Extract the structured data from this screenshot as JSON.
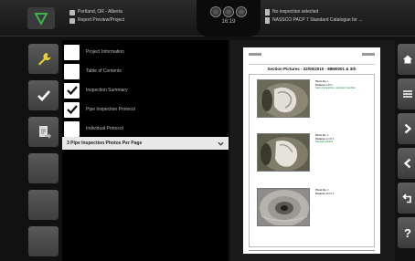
{
  "topbar": {
    "project_line1": "Portland, OR - Alberta",
    "project_line2": "Report Preview/Project",
    "clock": "16:19",
    "inspection_line1": "No inspection selected",
    "inspection_line2": "NASSCO PACP 7 Standard Catalogue for ..."
  },
  "sidebar": {
    "items": [
      {
        "icon": "wrench-icon",
        "active": true
      },
      {
        "icon": "checkmark-icon",
        "active": true
      },
      {
        "icon": "report-export-icon",
        "active": true
      },
      {
        "icon": "",
        "active": false
      },
      {
        "icon": "",
        "active": false
      },
      {
        "icon": "",
        "active": false
      }
    ]
  },
  "options": [
    {
      "label": "Project Information",
      "checked": false
    },
    {
      "label": "Table of Contents",
      "checked": false
    },
    {
      "label": "Inspection Summary",
      "checked": true
    },
    {
      "label": "Pipe Inspection Protocol",
      "checked": true
    },
    {
      "label": "Individual Protocol",
      "checked": false
    }
  ],
  "photo_layout": {
    "selected": "3 Pipe Inspection Photos Per Page"
  },
  "preview": {
    "title": "Section Pictures - 22/05/2010 - 88M0001 & 3th",
    "entries": [
      {
        "label_a": "Photo No.",
        "value_a": "1",
        "label_b": "Distance",
        "value_b": "0.00 ft",
        "note": "Start of inspection, upstream manhole"
      },
      {
        "label_a": "Photo No.",
        "value_a": "2",
        "label_b": "Distance",
        "value_b": "12.40 ft",
        "note": "Deposits settled"
      },
      {
        "label_a": "Photo No.",
        "value_a": "3",
        "label_b": "Distance",
        "value_b": "48.10 ft",
        "note": ""
      }
    ]
  },
  "rightnav": {
    "items": [
      "home-icon",
      "menu-icon",
      "next-icon",
      "previous-icon",
      "return-icon",
      "help-icon"
    ],
    "help_label": "?"
  },
  "colors": {
    "brand_green": "#3cb34a",
    "button_gray": "#4a4a4a",
    "background": "#111111"
  }
}
